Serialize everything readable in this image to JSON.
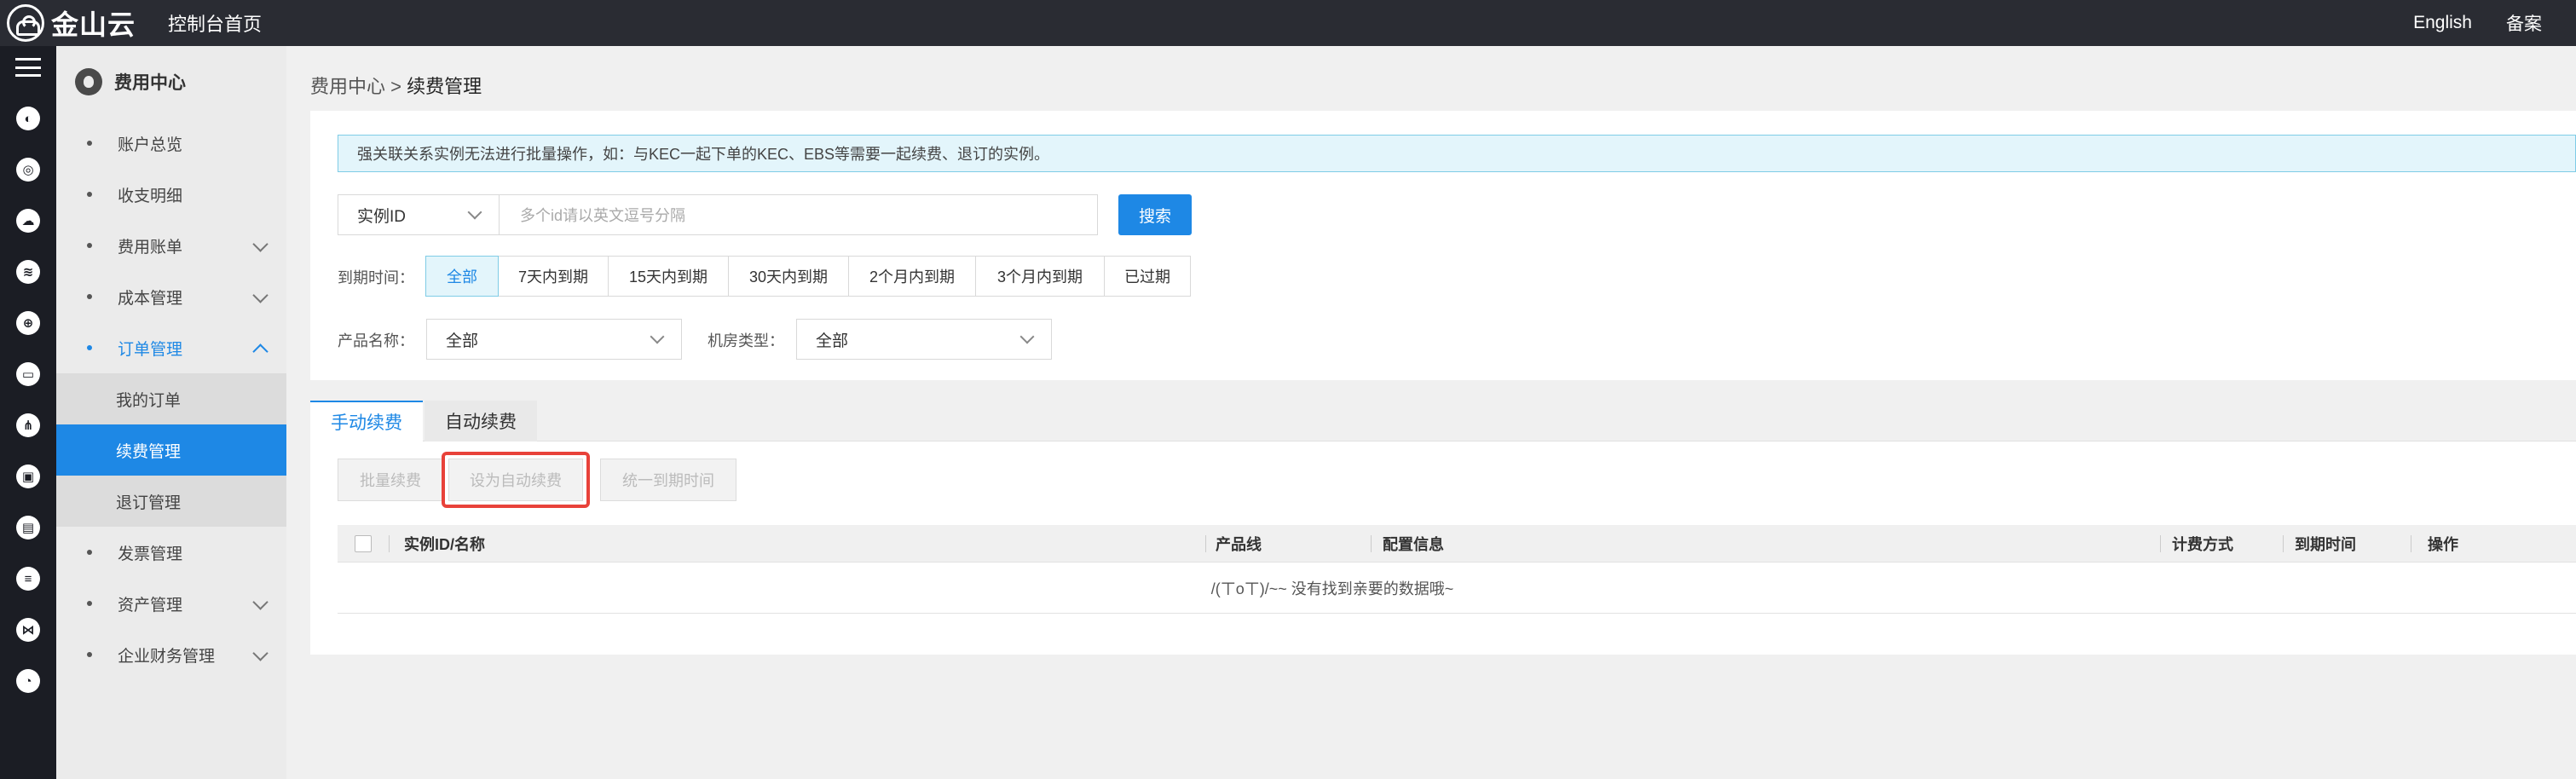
{
  "topbar": {
    "logo_text": "金山云",
    "home": "控制台首页",
    "english": "English",
    "beian": "备案"
  },
  "sidebar": {
    "title": "费用中心",
    "items": [
      {
        "label": "账户总览"
      },
      {
        "label": "收支明细"
      },
      {
        "label": "费用账单"
      },
      {
        "label": "成本管理"
      },
      {
        "label": "订单管理"
      },
      {
        "label": "发票管理"
      },
      {
        "label": "资产管理"
      },
      {
        "label": "企业财务管理"
      }
    ],
    "sub_items": [
      {
        "label": "我的订单"
      },
      {
        "label": "续费管理"
      },
      {
        "label": "退订管理"
      }
    ]
  },
  "breadcrumb": {
    "parent": "费用中心",
    "sep": ">",
    "current": "续费管理"
  },
  "notice": "强关联关系实例无法进行批量操作，如：与KEC一起下单的KEC、EBS等需要一起续费、退订的实例。",
  "search": {
    "field_value": "实例ID",
    "placeholder": "多个id请以英文逗号分隔",
    "button": "搜索"
  },
  "filters": {
    "expire_label": "到期时间：",
    "expire_options": [
      "全部",
      "7天内到期",
      "15天内到期",
      "30天内到期",
      "2个月内到期",
      "3个月内到期",
      "已过期"
    ],
    "product_label": "产品名称：",
    "product_value": "全部",
    "room_label": "机房类型：",
    "room_value": "全部"
  },
  "tabs": [
    "手动续费",
    "自动续费"
  ],
  "actions": {
    "batch": "批量续费",
    "set_auto": "设为自动续费",
    "unify": "统一到期时间"
  },
  "table": {
    "columns": [
      "实例ID/名称",
      "产品线",
      "配置信息",
      "计费方式",
      "到期时间",
      "操作"
    ],
    "empty_text": "/(ㄒoㄒ)/~~ 没有找到亲要的数据哦~"
  },
  "colors": {
    "accent": "#1e88e5",
    "highlight": "#e8423a",
    "topbar": "#2a2c33",
    "rail": "#1b1d24"
  }
}
